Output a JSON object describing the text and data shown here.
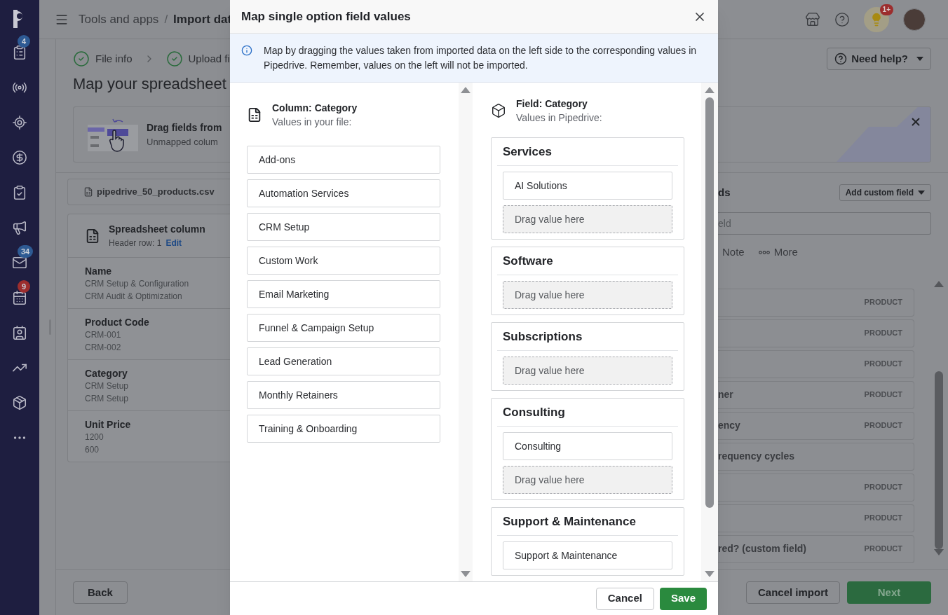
{
  "sidebar": {
    "items": [
      {
        "selected": false,
        "badge": "4",
        "color": "#2e5a93"
      },
      {
        "selected": false
      },
      {
        "selected": false
      },
      {
        "selected": false
      },
      {
        "selected": false
      },
      {
        "selected": false
      },
      {
        "selected": false,
        "badge": "34",
        "color": "#2e5a93"
      },
      {
        "selected": false,
        "badge": "9",
        "color": "#9c2d2d"
      },
      {
        "selected": false
      },
      {
        "selected": false
      },
      {
        "selected": false
      },
      {
        "selected": false
      }
    ]
  },
  "header": {
    "breadcrumb": [
      "Tools and apps",
      "/",
      "Import dat"
    ],
    "tips_badge": "1+"
  },
  "steps": [
    {
      "label": "File info",
      "done": true
    },
    {
      "label": "Upload fi",
      "done": true
    }
  ],
  "heading": "Map your spreadsheet",
  "banner": {
    "title": "Drag fields from",
    "subtitle": "Unmapped colum"
  },
  "file_tab": "pipedrive_50_products.csv",
  "spreadsheet": {
    "title": "Spreadsheet column",
    "header_row": "Header row: 1",
    "edit": "Edit",
    "columns": [
      {
        "name": "Name",
        "values": [
          "CRM Setup & Configuration",
          "CRM Audit & Optimization"
        ]
      },
      {
        "name": "Product Code",
        "values": [
          "CRM-001",
          "CRM-002"
        ]
      },
      {
        "name": "Category",
        "values": [
          "CRM Setup",
          "CRM Setup"
        ]
      },
      {
        "name": "Unit Price",
        "values": [
          "1200",
          "600"
        ]
      }
    ]
  },
  "back": "Back",
  "right": {
    "need_help": "Need help?",
    "section_title": "ds",
    "add_custom_field": "Add custom field",
    "search_placeholder": "eld",
    "tabs": [
      "Note",
      "More"
    ],
    "rows": [
      {
        "tag": "PRODUCT"
      },
      {
        "tag": "PRODUCT"
      },
      {
        "tag": "PRODUCT"
      },
      {
        "label": "ner",
        "tag": "PRODUCT"
      },
      {
        "label": "ency",
        "tag": "PRODUCT"
      },
      {
        "label": "requency cycles"
      },
      {
        "tag": "PRODUCT"
      },
      {
        "tag": "PRODUCT"
      },
      {
        "label": "**red?** (custom field)",
        "tag": "PRODUCT"
      }
    ],
    "cancel_import": "Cancel import",
    "next": "Next"
  },
  "modal": {
    "title": "Map single option field values",
    "info": "Map by dragging the values taken from imported data on the left side to the corresponding values in Pipedrive. Remember, values on the left will not be imported.",
    "left": {
      "heading": "Column: Category",
      "subheading": "Values in your file:",
      "values": [
        "Add-ons",
        "Automation Services",
        "CRM Setup",
        "Custom Work",
        "Email Marketing",
        "Funnel & Campaign Setup",
        "Lead Generation",
        "Monthly Retainers",
        "Training & Onboarding"
      ]
    },
    "right": {
      "heading": "Field: Category",
      "subheading": "Values in Pipedrive:",
      "groups": [
        {
          "name": "Services",
          "values": [
            "AI Solutions"
          ],
          "drop": "Drag value here"
        },
        {
          "name": "Software",
          "drop": "Drag value here"
        },
        {
          "name": "Subscriptions",
          "drop": "Drag value here"
        },
        {
          "name": "Consulting",
          "values": [
            "Consulting"
          ],
          "drop": "Drag value here"
        },
        {
          "name": "Support & Maintenance",
          "values": [
            "Support & Maintenance"
          ]
        }
      ]
    },
    "cancel": "Cancel",
    "save": "Save"
  }
}
